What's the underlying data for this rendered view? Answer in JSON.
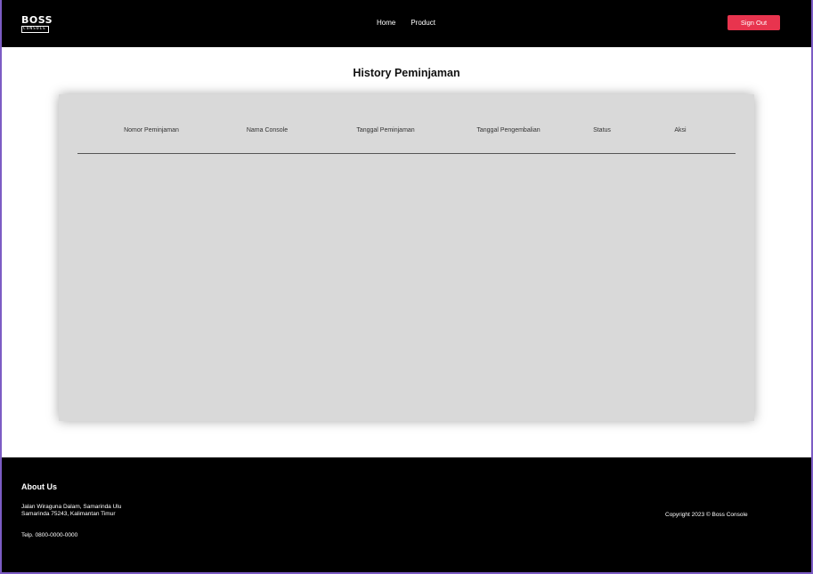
{
  "header": {
    "logo_main": "BOSS",
    "logo_sub": "CONSOLE",
    "nav": [
      {
        "label": "Home"
      },
      {
        "label": "Product"
      }
    ],
    "sign_out_label": "Sign Out"
  },
  "main": {
    "title": "History Peminjaman",
    "table": {
      "columns": [
        "Nomor Peminjaman",
        "Nama Console",
        "Tanggal Peminjaman",
        "Tanggal Pengembalian",
        "Status",
        "Aksi"
      ],
      "rows": []
    }
  },
  "footer": {
    "about_title": "About Us",
    "address_line1": "Jalan Wiraguna Dalam, Samarinda Ulu",
    "address_line2": "Samarinda 75243, Kalimantan Timur",
    "phone": "Telp. 0800-0000-0000",
    "copyright": "Copyright 2023 © Boss Console"
  },
  "colors": {
    "header_bg": "#000000",
    "accent": "#e8344e",
    "card_bg": "#d9d9d9",
    "footer_bg": "#000000"
  }
}
